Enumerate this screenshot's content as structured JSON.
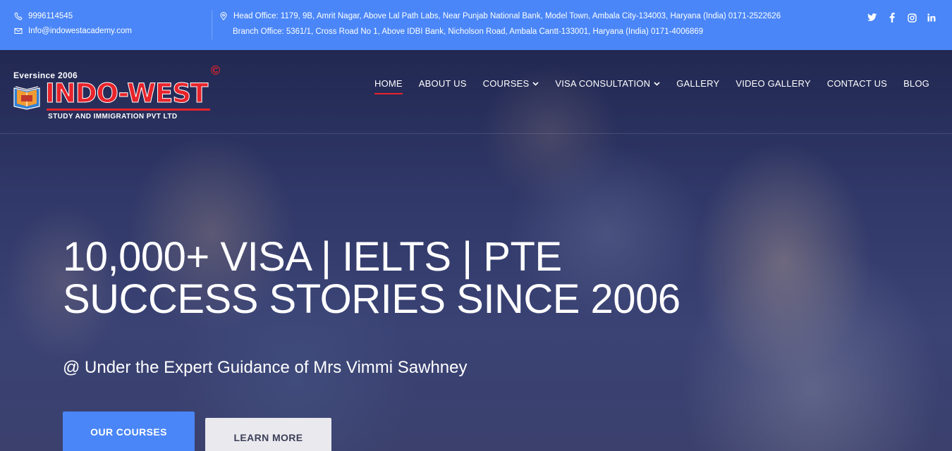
{
  "topbar": {
    "phone": "9996114545",
    "email": "Info@indowestacademy.com",
    "head_office": "Head Office: 1179, 9B, Amrit Nagar, Above Lal Path Labs, Near Punjab National Bank, Model Town, Ambala City-134003, Haryana (India) 0171-2522626",
    "branch_office": "Branch Office: 5361/1, Cross Road No 1, Above IDBI Bank, Nicholson Road, Ambala Cantt-133001, Haryana (India) 0171-4006869",
    "social_icons": [
      "twitter-icon",
      "facebook-icon",
      "instagram-icon",
      "linkedin-icon"
    ]
  },
  "logo": {
    "eversince": "Eversince 2006",
    "brand": "INDO-WEST",
    "copyright": "©",
    "tagline": "STUDY AND IMMIGRATION PVT LTD"
  },
  "nav": {
    "items": [
      {
        "label": "HOME"
      },
      {
        "label": "ABOUT US"
      },
      {
        "label": "COURSES"
      },
      {
        "label": "VISA CONSULTATION"
      },
      {
        "label": "GALLERY"
      },
      {
        "label": "VIDEO GALLERY"
      },
      {
        "label": "CONTACT US"
      },
      {
        "label": "BLOG"
      }
    ]
  },
  "hero": {
    "headline_line1": "10,000+ VISA | IELTS | PTE",
    "headline_line2": "SUCCESS STORIES SINCE 2006",
    "subheadline": "@ Under the Expert Guidance of Mrs Vimmi Sawhney",
    "primary_button": "OUR COURSES",
    "secondary_button": "LEARN MORE"
  },
  "colors": {
    "accent_blue": "#4a86f7",
    "brand_red": "#e8232b",
    "hero_overlay": "#22264a"
  }
}
